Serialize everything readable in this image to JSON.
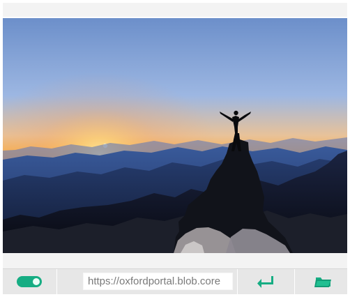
{
  "colors": {
    "accent": "#16ad83",
    "toolbar_background": "#e7e7e7",
    "window_background": "#f3f3f3",
    "url_text": "#7a7a7a"
  },
  "image": {
    "description_icon": "mountain-sunset-photo-icon"
  },
  "toolbar": {
    "toggle": {
      "icon": "toggle-switch-icon",
      "state": "on"
    },
    "url": {
      "value": "https://oxfordportal.blob.core"
    },
    "enter_button": {
      "icon": "enter-return-icon"
    },
    "folder_button": {
      "icon": "folder-icon"
    }
  }
}
